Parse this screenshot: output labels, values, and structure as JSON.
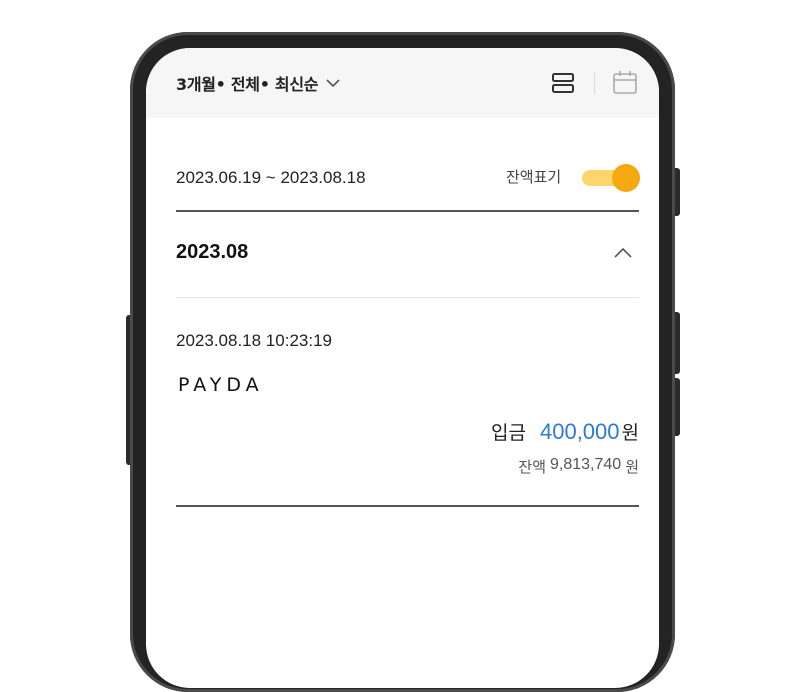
{
  "filter": {
    "label": "3개월• 전체• 최신순"
  },
  "period": {
    "range": "2023.06.19 ~ 2023.08.18",
    "balance_toggle_label": "잔액표기",
    "balance_toggle_on": true
  },
  "month_group": {
    "title": "2023.08"
  },
  "transaction": {
    "timestamp": "2023.08.18 10:23:19",
    "merchant": "PAYDA",
    "type": "입금",
    "amount": "400,000",
    "amount_unit": "원",
    "balance_label": "잔액",
    "balance_value": "9,813,740",
    "balance_unit": "원"
  },
  "colors": {
    "accent_amount": "#2f78d6",
    "toggle_knob": "#f5a90e",
    "toggle_track": "#ffd46a"
  },
  "icons": [
    "chevron-down-icon",
    "list-view-icon",
    "calendar-icon",
    "chevron-up-icon"
  ]
}
